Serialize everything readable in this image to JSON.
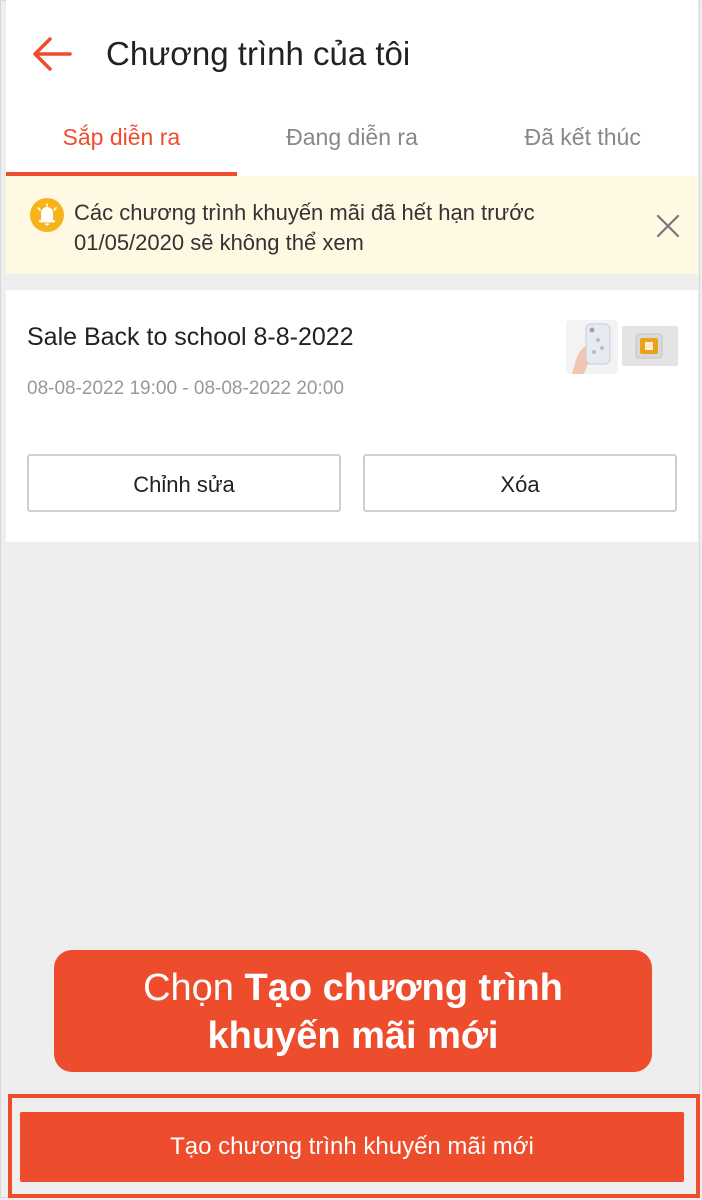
{
  "header": {
    "title": "Chương trình của tôi"
  },
  "tabs": [
    {
      "label": "Sắp diễn ra",
      "active": true
    },
    {
      "label": "Đang diễn ra",
      "active": false
    },
    {
      "label": "Đã kết thúc",
      "active": false
    }
  ],
  "notice": {
    "text_line1": "Các chương trình khuyến mãi đã hết hạn trước",
    "text_line2": "01/05/2020 sẽ không thể xem"
  },
  "program": {
    "title": "Sale Back to school 8-8-2022",
    "time": "08-08-2022 19:00 - 08-08-2022 20:00",
    "edit_label": "Chỉnh sửa",
    "delete_label": "Xóa"
  },
  "callout": {
    "prefix": "Chọn ",
    "bold_line1": "Tạo chương trình",
    "bold_line2": "khuyến mãi mới"
  },
  "bottom": {
    "create_label": "Tạo chương trình khuyến mãi mới"
  },
  "colors": {
    "accent": "#ee4d2d",
    "notice_bg": "#fff8e3",
    "bell": "#f7b319"
  }
}
